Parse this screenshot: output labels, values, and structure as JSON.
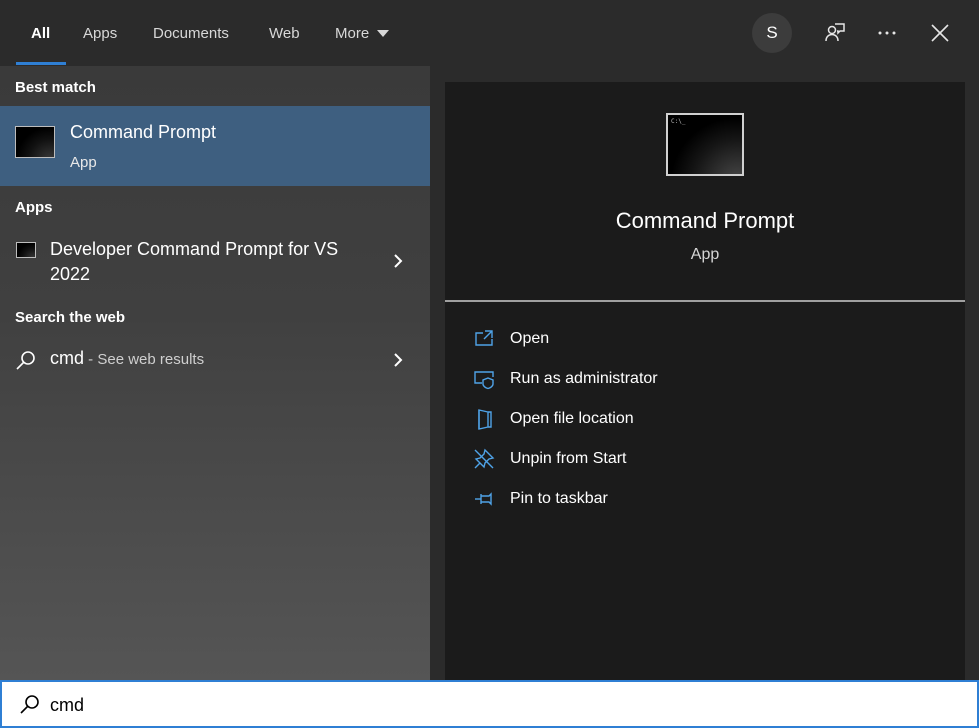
{
  "tabs": [
    {
      "label": "All"
    },
    {
      "label": "Apps"
    },
    {
      "label": "Documents"
    },
    {
      "label": "Web"
    },
    {
      "label": "More"
    }
  ],
  "avatar_initial": "S",
  "sections": {
    "best_match": "Best match",
    "apps": "Apps",
    "search_web": "Search the web"
  },
  "best_match_item": {
    "title": "Command Prompt",
    "subtitle": "App"
  },
  "app_item": {
    "title": "Developer Command Prompt for VS 2022"
  },
  "web_item": {
    "query": "cmd",
    "suffix": " - See web results"
  },
  "detail": {
    "title": "Command Prompt",
    "subtitle": "App",
    "actions": [
      {
        "label": "Open",
        "icon": "open-icon"
      },
      {
        "label": "Run as administrator",
        "icon": "shield-icon"
      },
      {
        "label": "Open file location",
        "icon": "folder-icon"
      },
      {
        "label": "Unpin from Start",
        "icon": "unpin-icon"
      },
      {
        "label": "Pin to taskbar",
        "icon": "pin-icon"
      }
    ]
  },
  "search": {
    "value": "cmd"
  },
  "colors": {
    "accent": "#2f7fd4",
    "selected_row": "#3e5f80"
  }
}
